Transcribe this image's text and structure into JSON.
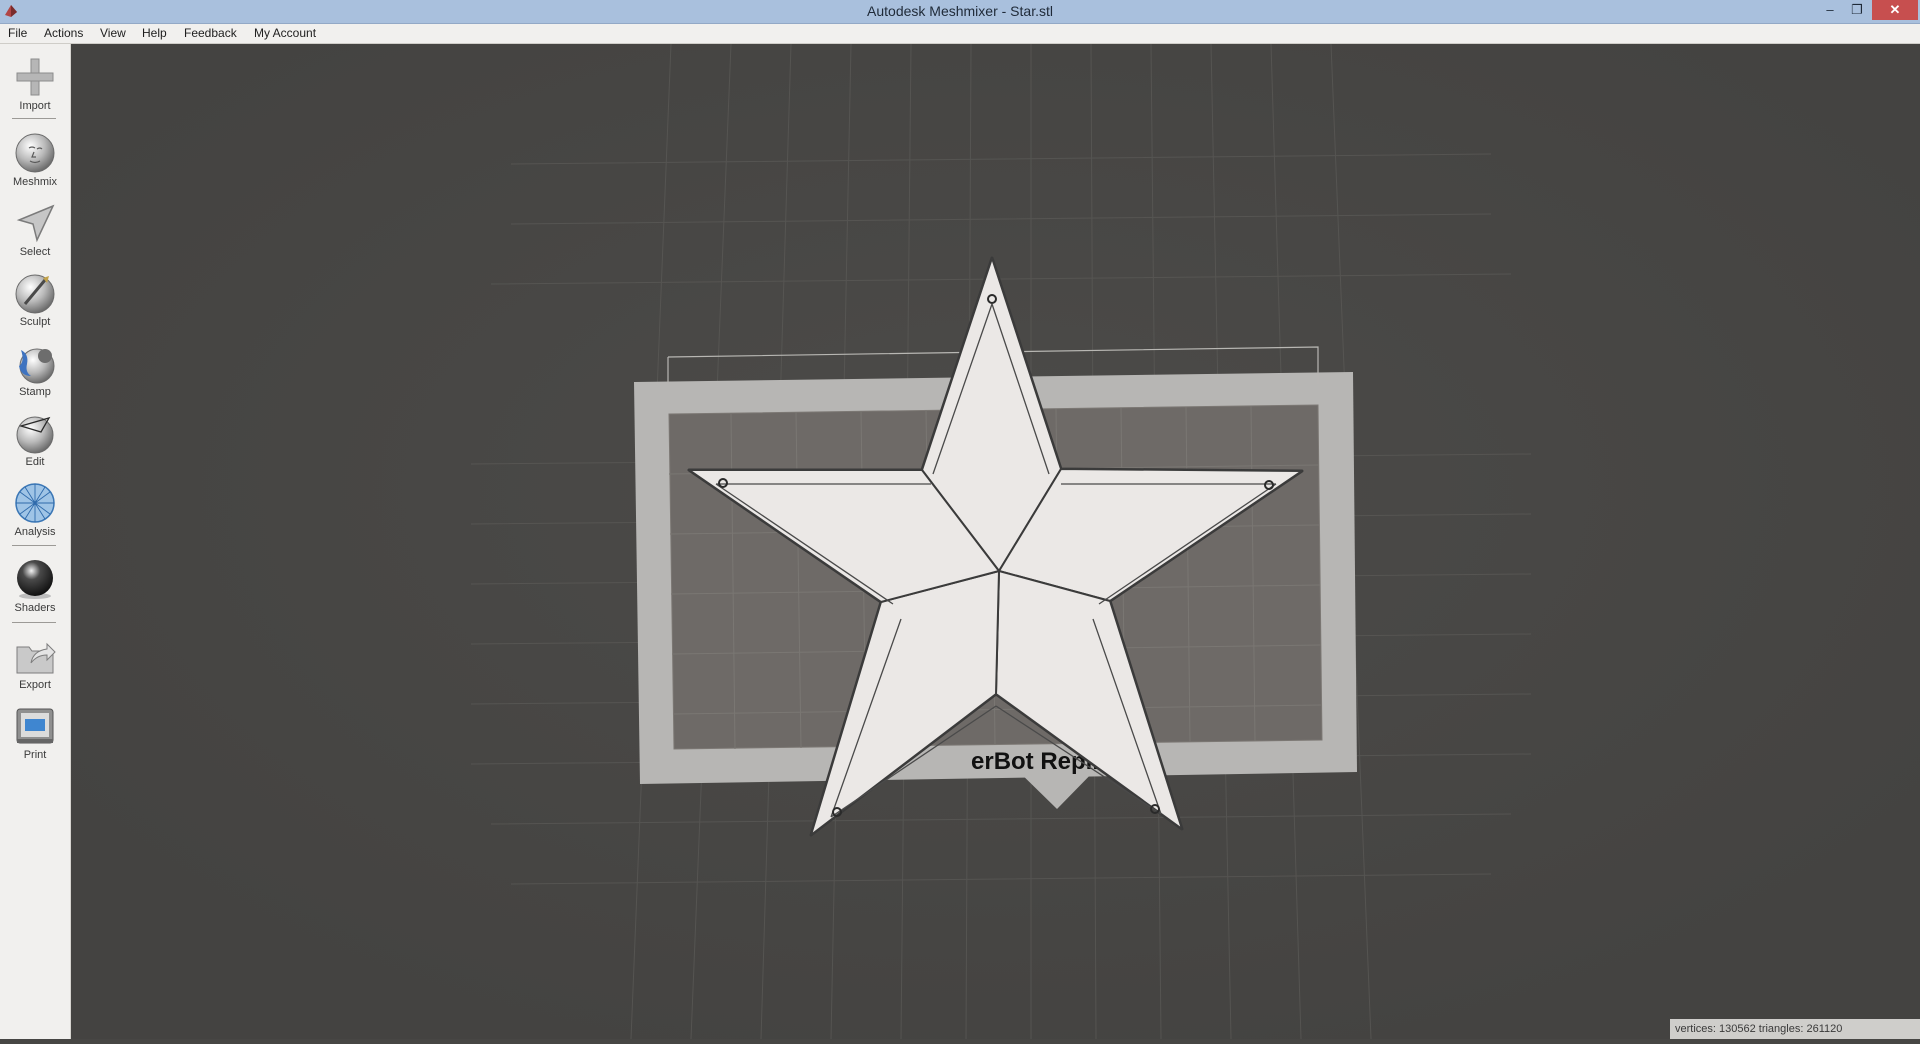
{
  "window": {
    "title": "Autodesk Meshmixer - Star.stl",
    "minimize": "–",
    "restore": "❐",
    "close": "✕"
  },
  "menu": [
    "File",
    "Actions",
    "View",
    "Help",
    "Feedback",
    "My Account"
  ],
  "toolbar": {
    "import": "Import",
    "meshmix": "Meshmix",
    "select": "Select",
    "sculpt": "Sculpt",
    "stamp": "Stamp",
    "edit": "Edit",
    "analysis": "Analysis",
    "shaders": "Shaders",
    "export": "Export",
    "print": "Print"
  },
  "viewport": {
    "build_plate_label": "erBot Replicat"
  },
  "status": "vertices: 130562 triangles: 261120"
}
